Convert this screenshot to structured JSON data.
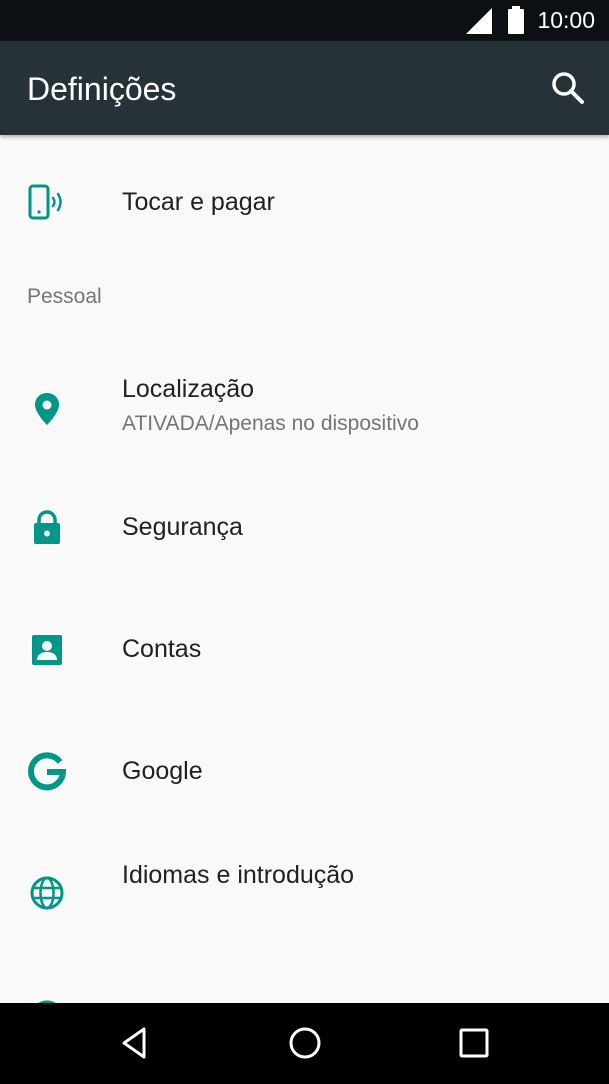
{
  "status_bar": {
    "time": "10:00"
  },
  "toolbar": {
    "title": "Definições"
  },
  "items": {
    "tap_pay": {
      "label": "Tocar e pagar"
    },
    "location": {
      "label": "Localização",
      "summary": "ATIVADA/Apenas no dispositivo"
    },
    "security": {
      "label": "Segurança"
    },
    "accounts": {
      "label": "Contas"
    },
    "google": {
      "label": "Google"
    },
    "languages": {
      "label": "Idiomas e introdução"
    }
  },
  "sections": {
    "personal": "Pessoal"
  },
  "colors": {
    "accent": "#009688",
    "toolbar": "#263238",
    "background": "#f9f9f9",
    "status_bar": "#0d1012"
  }
}
